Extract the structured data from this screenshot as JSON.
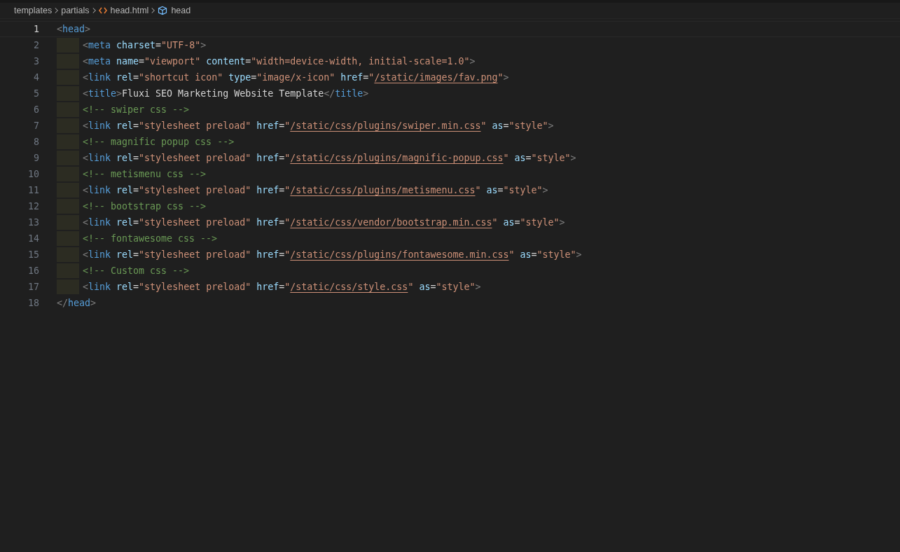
{
  "breadcrumb": [
    {
      "label": "templates",
      "kind": "folder"
    },
    {
      "label": "partials",
      "kind": "folder"
    },
    {
      "label": "head.html",
      "kind": "file"
    },
    {
      "label": "head",
      "kind": "symbol"
    }
  ],
  "editor": {
    "lines": [
      {
        "number": "1",
        "current": true,
        "indented": false,
        "tokens": [
          {
            "text": "<",
            "kind": "punct"
          },
          {
            "text": "head",
            "kind": "tag"
          },
          {
            "text": ">",
            "kind": "punct"
          }
        ]
      },
      {
        "number": "2",
        "current": false,
        "indented": true,
        "tokens": [
          {
            "text": "<",
            "kind": "punct"
          },
          {
            "text": "meta",
            "kind": "tag"
          },
          {
            "text": " charset",
            "kind": "attr"
          },
          {
            "text": "=",
            "kind": "eq"
          },
          {
            "text": "\"UTF-8\"",
            "kind": "string"
          },
          {
            "text": ">",
            "kind": "punct"
          }
        ]
      },
      {
        "number": "3",
        "current": false,
        "indented": true,
        "tokens": [
          {
            "text": "<",
            "kind": "punct"
          },
          {
            "text": "meta",
            "kind": "tag"
          },
          {
            "text": " name",
            "kind": "attr"
          },
          {
            "text": "=",
            "kind": "eq"
          },
          {
            "text": "\"viewport\"",
            "kind": "string"
          },
          {
            "text": " content",
            "kind": "attr"
          },
          {
            "text": "=",
            "kind": "eq"
          },
          {
            "text": "\"width=device-width, initial-scale=1.0\"",
            "kind": "string"
          },
          {
            "text": ">",
            "kind": "punct"
          }
        ]
      },
      {
        "number": "4",
        "current": false,
        "indented": true,
        "tokens": [
          {
            "text": "<",
            "kind": "punct"
          },
          {
            "text": "link",
            "kind": "tag"
          },
          {
            "text": " rel",
            "kind": "attr"
          },
          {
            "text": "=",
            "kind": "eq"
          },
          {
            "text": "\"shortcut icon\"",
            "kind": "string"
          },
          {
            "text": " type",
            "kind": "attr"
          },
          {
            "text": "=",
            "kind": "eq"
          },
          {
            "text": "\"image/x-icon\"",
            "kind": "string"
          },
          {
            "text": " href",
            "kind": "attr"
          },
          {
            "text": "=",
            "kind": "eq"
          },
          {
            "text": "\"",
            "kind": "string"
          },
          {
            "text": "/static/images/fav.png",
            "kind": "link"
          },
          {
            "text": "\"",
            "kind": "string"
          },
          {
            "text": ">",
            "kind": "punct"
          }
        ]
      },
      {
        "number": "5",
        "current": false,
        "indented": true,
        "tokens": [
          {
            "text": "<",
            "kind": "punct"
          },
          {
            "text": "title",
            "kind": "tag"
          },
          {
            "text": ">",
            "kind": "punct"
          },
          {
            "text": "Fluxi SEO Marketing Website Template",
            "kind": "text"
          },
          {
            "text": "</",
            "kind": "punct"
          },
          {
            "text": "title",
            "kind": "tag"
          },
          {
            "text": ">",
            "kind": "punct"
          }
        ]
      },
      {
        "number": "6",
        "current": false,
        "indented": true,
        "tokens": [
          {
            "text": "<!-- swiper css -->",
            "kind": "comment"
          }
        ]
      },
      {
        "number": "7",
        "current": false,
        "indented": true,
        "tokens": [
          {
            "text": "<",
            "kind": "punct"
          },
          {
            "text": "link",
            "kind": "tag"
          },
          {
            "text": " rel",
            "kind": "attr"
          },
          {
            "text": "=",
            "kind": "eq"
          },
          {
            "text": "\"stylesheet preload\"",
            "kind": "string"
          },
          {
            "text": " href",
            "kind": "attr"
          },
          {
            "text": "=",
            "kind": "eq"
          },
          {
            "text": "\"",
            "kind": "string"
          },
          {
            "text": "/static/css/plugins/swiper.min.css",
            "kind": "link"
          },
          {
            "text": "\"",
            "kind": "string"
          },
          {
            "text": " as",
            "kind": "attr"
          },
          {
            "text": "=",
            "kind": "eq"
          },
          {
            "text": "\"style\"",
            "kind": "string"
          },
          {
            "text": ">",
            "kind": "punct"
          }
        ]
      },
      {
        "number": "8",
        "current": false,
        "indented": true,
        "tokens": [
          {
            "text": "<!-- magnific popup css -->",
            "kind": "comment"
          }
        ]
      },
      {
        "number": "9",
        "current": false,
        "indented": true,
        "tokens": [
          {
            "text": "<",
            "kind": "punct"
          },
          {
            "text": "link",
            "kind": "tag"
          },
          {
            "text": " rel",
            "kind": "attr"
          },
          {
            "text": "=",
            "kind": "eq"
          },
          {
            "text": "\"stylesheet preload\"",
            "kind": "string"
          },
          {
            "text": " href",
            "kind": "attr"
          },
          {
            "text": "=",
            "kind": "eq"
          },
          {
            "text": "\"",
            "kind": "string"
          },
          {
            "text": "/static/css/plugins/magnific-popup.css",
            "kind": "link"
          },
          {
            "text": "\"",
            "kind": "string"
          },
          {
            "text": " as",
            "kind": "attr"
          },
          {
            "text": "=",
            "kind": "eq"
          },
          {
            "text": "\"style\"",
            "kind": "string"
          },
          {
            "text": ">",
            "kind": "punct"
          }
        ]
      },
      {
        "number": "10",
        "current": false,
        "indented": true,
        "tokens": [
          {
            "text": "<!-- metismenu css -->",
            "kind": "comment"
          }
        ]
      },
      {
        "number": "11",
        "current": false,
        "indented": true,
        "tokens": [
          {
            "text": "<",
            "kind": "punct"
          },
          {
            "text": "link",
            "kind": "tag"
          },
          {
            "text": " rel",
            "kind": "attr"
          },
          {
            "text": "=",
            "kind": "eq"
          },
          {
            "text": "\"stylesheet preload\"",
            "kind": "string"
          },
          {
            "text": " href",
            "kind": "attr"
          },
          {
            "text": "=",
            "kind": "eq"
          },
          {
            "text": "\"",
            "kind": "string"
          },
          {
            "text": "/static/css/plugins/metismenu.css",
            "kind": "link"
          },
          {
            "text": "\"",
            "kind": "string"
          },
          {
            "text": " as",
            "kind": "attr"
          },
          {
            "text": "=",
            "kind": "eq"
          },
          {
            "text": "\"style\"",
            "kind": "string"
          },
          {
            "text": ">",
            "kind": "punct"
          }
        ]
      },
      {
        "number": "12",
        "current": false,
        "indented": true,
        "tokens": [
          {
            "text": "<!-- bootstrap css -->",
            "kind": "comment"
          }
        ]
      },
      {
        "number": "13",
        "current": false,
        "indented": true,
        "tokens": [
          {
            "text": "<",
            "kind": "punct"
          },
          {
            "text": "link",
            "kind": "tag"
          },
          {
            "text": " rel",
            "kind": "attr"
          },
          {
            "text": "=",
            "kind": "eq"
          },
          {
            "text": "\"stylesheet preload\"",
            "kind": "string"
          },
          {
            "text": " href",
            "kind": "attr"
          },
          {
            "text": "=",
            "kind": "eq"
          },
          {
            "text": "\"",
            "kind": "string"
          },
          {
            "text": "/static/css/vendor/bootstrap.min.css",
            "kind": "link"
          },
          {
            "text": "\"",
            "kind": "string"
          },
          {
            "text": " as",
            "kind": "attr"
          },
          {
            "text": "=",
            "kind": "eq"
          },
          {
            "text": "\"style\"",
            "kind": "string"
          },
          {
            "text": ">",
            "kind": "punct"
          }
        ]
      },
      {
        "number": "14",
        "current": false,
        "indented": true,
        "tokens": [
          {
            "text": "<!-- fontawesome css -->",
            "kind": "comment"
          }
        ]
      },
      {
        "number": "15",
        "current": false,
        "indented": true,
        "tokens": [
          {
            "text": "<",
            "kind": "punct"
          },
          {
            "text": "link",
            "kind": "tag"
          },
          {
            "text": " rel",
            "kind": "attr"
          },
          {
            "text": "=",
            "kind": "eq"
          },
          {
            "text": "\"stylesheet preload\"",
            "kind": "string"
          },
          {
            "text": " href",
            "kind": "attr"
          },
          {
            "text": "=",
            "kind": "eq"
          },
          {
            "text": "\"",
            "kind": "string"
          },
          {
            "text": "/static/css/plugins/fontawesome.min.css",
            "kind": "link"
          },
          {
            "text": "\"",
            "kind": "string"
          },
          {
            "text": " as",
            "kind": "attr"
          },
          {
            "text": "=",
            "kind": "eq"
          },
          {
            "text": "\"style\"",
            "kind": "string"
          },
          {
            "text": ">",
            "kind": "punct"
          }
        ]
      },
      {
        "number": "16",
        "current": false,
        "indented": true,
        "tokens": [
          {
            "text": "<!-- Custom css -->",
            "kind": "comment"
          }
        ]
      },
      {
        "number": "17",
        "current": false,
        "indented": true,
        "tokens": [
          {
            "text": "<",
            "kind": "punct"
          },
          {
            "text": "link",
            "kind": "tag"
          },
          {
            "text": " rel",
            "kind": "attr"
          },
          {
            "text": "=",
            "kind": "eq"
          },
          {
            "text": "\"stylesheet preload\"",
            "kind": "string"
          },
          {
            "text": " href",
            "kind": "attr"
          },
          {
            "text": "=",
            "kind": "eq"
          },
          {
            "text": "\"",
            "kind": "string"
          },
          {
            "text": "/static/css/style.css",
            "kind": "link"
          },
          {
            "text": "\"",
            "kind": "string"
          },
          {
            "text": " as",
            "kind": "attr"
          },
          {
            "text": "=",
            "kind": "eq"
          },
          {
            "text": "\"style\"",
            "kind": "string"
          },
          {
            "text": ">",
            "kind": "punct"
          }
        ]
      },
      {
        "number": "18",
        "current": false,
        "indented": false,
        "tokens": [
          {
            "text": "</",
            "kind": "punct"
          },
          {
            "text": "head",
            "kind": "tag"
          },
          {
            "text": ">",
            "kind": "punct"
          }
        ]
      }
    ]
  }
}
